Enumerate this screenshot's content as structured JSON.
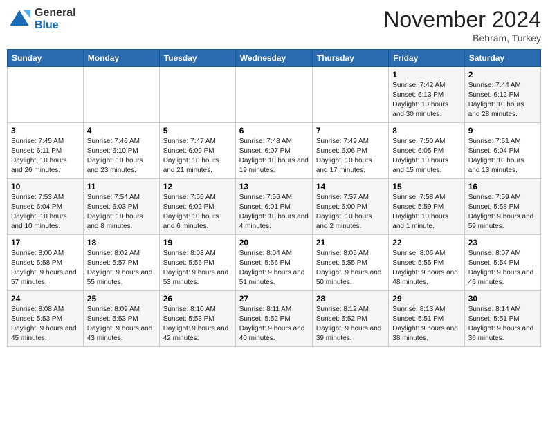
{
  "header": {
    "logo_general": "General",
    "logo_blue": "Blue",
    "month": "November 2024",
    "location": "Behram, Turkey"
  },
  "weekdays": [
    "Sunday",
    "Monday",
    "Tuesday",
    "Wednesday",
    "Thursday",
    "Friday",
    "Saturday"
  ],
  "weeks": [
    [
      {
        "day": "",
        "info": ""
      },
      {
        "day": "",
        "info": ""
      },
      {
        "day": "",
        "info": ""
      },
      {
        "day": "",
        "info": ""
      },
      {
        "day": "",
        "info": ""
      },
      {
        "day": "1",
        "info": "Sunrise: 7:42 AM\nSunset: 6:13 PM\nDaylight: 10 hours and 30 minutes."
      },
      {
        "day": "2",
        "info": "Sunrise: 7:44 AM\nSunset: 6:12 PM\nDaylight: 10 hours and 28 minutes."
      }
    ],
    [
      {
        "day": "3",
        "info": "Sunrise: 7:45 AM\nSunset: 6:11 PM\nDaylight: 10 hours and 26 minutes."
      },
      {
        "day": "4",
        "info": "Sunrise: 7:46 AM\nSunset: 6:10 PM\nDaylight: 10 hours and 23 minutes."
      },
      {
        "day": "5",
        "info": "Sunrise: 7:47 AM\nSunset: 6:09 PM\nDaylight: 10 hours and 21 minutes."
      },
      {
        "day": "6",
        "info": "Sunrise: 7:48 AM\nSunset: 6:07 PM\nDaylight: 10 hours and 19 minutes."
      },
      {
        "day": "7",
        "info": "Sunrise: 7:49 AM\nSunset: 6:06 PM\nDaylight: 10 hours and 17 minutes."
      },
      {
        "day": "8",
        "info": "Sunrise: 7:50 AM\nSunset: 6:05 PM\nDaylight: 10 hours and 15 minutes."
      },
      {
        "day": "9",
        "info": "Sunrise: 7:51 AM\nSunset: 6:04 PM\nDaylight: 10 hours and 13 minutes."
      }
    ],
    [
      {
        "day": "10",
        "info": "Sunrise: 7:53 AM\nSunset: 6:04 PM\nDaylight: 10 hours and 10 minutes."
      },
      {
        "day": "11",
        "info": "Sunrise: 7:54 AM\nSunset: 6:03 PM\nDaylight: 10 hours and 8 minutes."
      },
      {
        "day": "12",
        "info": "Sunrise: 7:55 AM\nSunset: 6:02 PM\nDaylight: 10 hours and 6 minutes."
      },
      {
        "day": "13",
        "info": "Sunrise: 7:56 AM\nSunset: 6:01 PM\nDaylight: 10 hours and 4 minutes."
      },
      {
        "day": "14",
        "info": "Sunrise: 7:57 AM\nSunset: 6:00 PM\nDaylight: 10 hours and 2 minutes."
      },
      {
        "day": "15",
        "info": "Sunrise: 7:58 AM\nSunset: 5:59 PM\nDaylight: 10 hours and 1 minute."
      },
      {
        "day": "16",
        "info": "Sunrise: 7:59 AM\nSunset: 5:58 PM\nDaylight: 9 hours and 59 minutes."
      }
    ],
    [
      {
        "day": "17",
        "info": "Sunrise: 8:00 AM\nSunset: 5:58 PM\nDaylight: 9 hours and 57 minutes."
      },
      {
        "day": "18",
        "info": "Sunrise: 8:02 AM\nSunset: 5:57 PM\nDaylight: 9 hours and 55 minutes."
      },
      {
        "day": "19",
        "info": "Sunrise: 8:03 AM\nSunset: 5:56 PM\nDaylight: 9 hours and 53 minutes."
      },
      {
        "day": "20",
        "info": "Sunrise: 8:04 AM\nSunset: 5:56 PM\nDaylight: 9 hours and 51 minutes."
      },
      {
        "day": "21",
        "info": "Sunrise: 8:05 AM\nSunset: 5:55 PM\nDaylight: 9 hours and 50 minutes."
      },
      {
        "day": "22",
        "info": "Sunrise: 8:06 AM\nSunset: 5:55 PM\nDaylight: 9 hours and 48 minutes."
      },
      {
        "day": "23",
        "info": "Sunrise: 8:07 AM\nSunset: 5:54 PM\nDaylight: 9 hours and 46 minutes."
      }
    ],
    [
      {
        "day": "24",
        "info": "Sunrise: 8:08 AM\nSunset: 5:53 PM\nDaylight: 9 hours and 45 minutes."
      },
      {
        "day": "25",
        "info": "Sunrise: 8:09 AM\nSunset: 5:53 PM\nDaylight: 9 hours and 43 minutes."
      },
      {
        "day": "26",
        "info": "Sunrise: 8:10 AM\nSunset: 5:53 PM\nDaylight: 9 hours and 42 minutes."
      },
      {
        "day": "27",
        "info": "Sunrise: 8:11 AM\nSunset: 5:52 PM\nDaylight: 9 hours and 40 minutes."
      },
      {
        "day": "28",
        "info": "Sunrise: 8:12 AM\nSunset: 5:52 PM\nDaylight: 9 hours and 39 minutes."
      },
      {
        "day": "29",
        "info": "Sunrise: 8:13 AM\nSunset: 5:51 PM\nDaylight: 9 hours and 38 minutes."
      },
      {
        "day": "30",
        "info": "Sunrise: 8:14 AM\nSunset: 5:51 PM\nDaylight: 9 hours and 36 minutes."
      }
    ]
  ]
}
